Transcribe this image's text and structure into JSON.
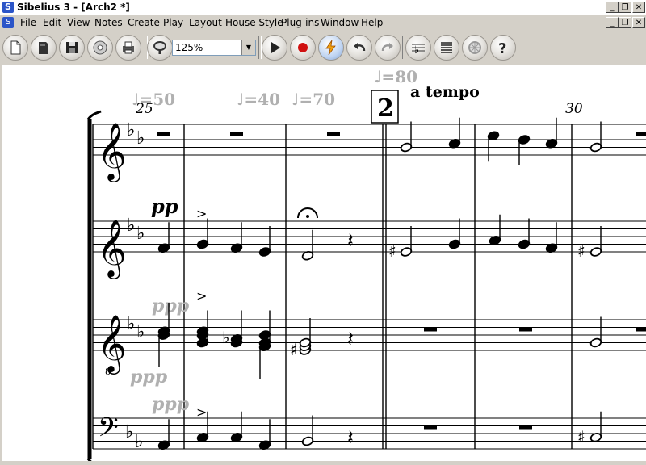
{
  "window": {
    "title": "Sibelius 3 - [Arch2 *]"
  },
  "menu": [
    {
      "label": "File",
      "ul": "F",
      "rest": "ile"
    },
    {
      "label": "Edit",
      "ul": "E",
      "rest": "dit"
    },
    {
      "label": "View",
      "ul": "V",
      "rest": "iew"
    },
    {
      "label": "Notes",
      "ul": "N",
      "rest": "otes"
    },
    {
      "label": "Create",
      "ul": "C",
      "rest": "reate"
    },
    {
      "label": "Play",
      "ul": "P",
      "rest": "lay"
    },
    {
      "label": "Layout",
      "ul": "L",
      "rest": "ayout"
    },
    {
      "label": "House Style",
      "ul": "",
      "rest": "House Style"
    },
    {
      "label": "Plug-ins",
      "ul": "",
      "rest": "Plug-ins"
    },
    {
      "label": "Window",
      "ul": "W",
      "rest": "indow"
    },
    {
      "label": "Help",
      "ul": "H",
      "rest": "elp"
    }
  ],
  "toolbar": {
    "zoom_value": "125%",
    "buttons": [
      "new-icon",
      "open-icon",
      "save-icon",
      "cd-icon",
      "print-icon",
      "magnifier-icon",
      "play-icon",
      "record-icon",
      "live-playback-icon",
      "undo-icon",
      "redo-icon",
      "flat-notes-icon",
      "staff-lines-icon",
      "ideas-icon",
      "help-icon"
    ]
  },
  "score": {
    "tempo_marks": [
      "♩=50",
      "♩=40",
      "♩=70",
      "♩=80"
    ],
    "bar_number_start": "25",
    "bar_number_end": "30",
    "rehearsal_mark": "2",
    "text_expression": "a tempo",
    "dynamics": {
      "staff2": "pp",
      "staff3_upper": "ppp",
      "staff3_lower": "ppp",
      "staff4": "ppp"
    },
    "colors": {
      "note": "#000000",
      "hidden_grey": "#b0b0b0"
    }
  }
}
